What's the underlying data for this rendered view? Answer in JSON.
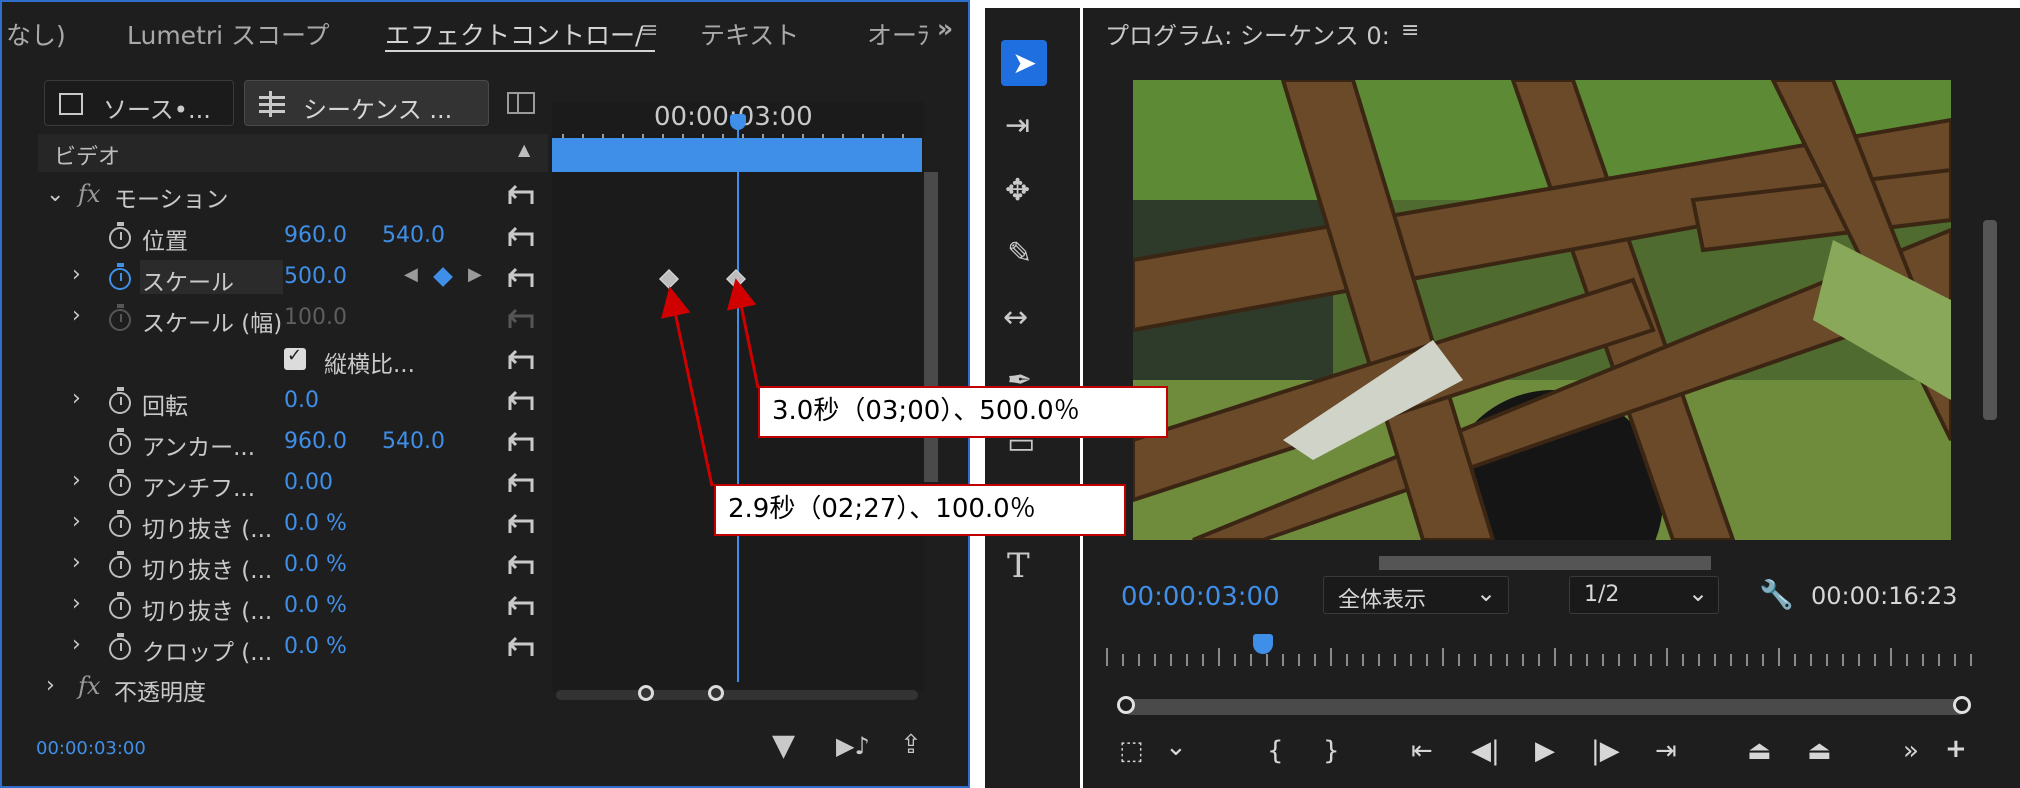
{
  "left_panel": {
    "tabs": [
      "なし)",
      "Lumetri スコープ",
      "エフェクトコントロー/",
      "テキスト",
      "オーﾗ"
    ],
    "overflow": "»",
    "source_button": "ソース•...",
    "sequence_button": "シーケンス ...",
    "section": "ビデオ",
    "motion_label": "モーション",
    "props": [
      {
        "label": "位置",
        "v1": "960.0",
        "v2": "540.0"
      },
      {
        "label": "スケール",
        "v1": "500.0"
      },
      {
        "label": "スケール (幅)",
        "v1": "100.0"
      },
      {
        "label": "縦横比..."
      },
      {
        "label": "回転",
        "v1": "0.0"
      },
      {
        "label": "アンカー...",
        "v1": "960.0",
        "v2": "540.0"
      },
      {
        "label": "アンチフ...",
        "v1": "0.00"
      },
      {
        "label": "切り抜き (...",
        "v1": "0.0 %"
      },
      {
        "label": "切り抜き (...",
        "v1": "0.0 %"
      },
      {
        "label": "切り抜き (...",
        "v1": "0.0 %"
      },
      {
        "label": "クロップ (...",
        "v1": "0.0 %"
      }
    ],
    "opacity_label": "不透明度",
    "timeline_time": "00:00:03:00",
    "current_time": "00:00:03:00"
  },
  "right_panel": {
    "title": "プログラム: シーケンス 0:",
    "current_time": "00:00:03:00",
    "zoom": "全体表示",
    "resolution": "1/2",
    "duration": "00:00:16:23"
  },
  "callouts": {
    "first": "3.0秒（03;00）、500.0％",
    "second": "2.9秒（02;27）、100.0％"
  },
  "colors": {
    "accent": "#3f8fe8",
    "panel_bg": "#1e1e1e",
    "callout_border": "#c00000"
  }
}
